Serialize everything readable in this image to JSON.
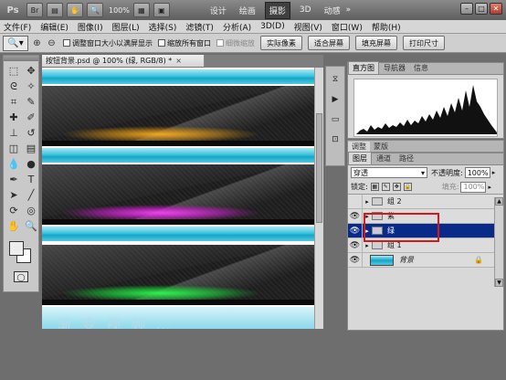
{
  "appbar": {
    "logo": "Ps",
    "zoom": "100%",
    "workspaces": [
      "设计",
      "绘画",
      "摄影",
      "3D",
      "动感"
    ],
    "active_workspace": "摄影",
    "more": "»"
  },
  "menu": [
    "文件(F)",
    "编辑(E)",
    "图像(I)",
    "图层(L)",
    "选择(S)",
    "滤镜(T)",
    "分析(A)",
    "3D(D)",
    "视图(V)",
    "窗口(W)",
    "帮助(H)"
  ],
  "options": {
    "checkbox_resize": "调整窗口大小以满屏显示",
    "checkbox_zoom_all": "缩放所有窗口",
    "checkbox_scrubby": "细微缩放",
    "btn_actual": "实际像素",
    "btn_fit": "适合屏幕",
    "btn_fill": "填充屏幕",
    "btn_print": "打印尺寸"
  },
  "document": {
    "tab_title": "按钮背景.psd @ 100% (绿, RGB/8) *",
    "close": "×",
    "faint_text": "渐 变 视 频 …"
  },
  "histogram": {
    "tabs": [
      "直方图",
      "导航器",
      "信息"
    ]
  },
  "adjust": {
    "tabs": [
      "调整",
      "蒙版"
    ]
  },
  "layers_panel": {
    "tabs": [
      "图层",
      "通道",
      "路径"
    ],
    "blend_mode": "穿透",
    "opacity_label": "不透明度:",
    "opacity_value": "100%",
    "lock_label": "锁定:",
    "fill_label": "填充:",
    "fill_value": "100%",
    "layers": [
      {
        "name": "组 2",
        "visible": false,
        "type": "group",
        "selected": false
      },
      {
        "name": "紫",
        "visible": true,
        "type": "group",
        "selected": false
      },
      {
        "name": "绿",
        "visible": true,
        "type": "group",
        "selected": true
      },
      {
        "name": "组 1",
        "visible": true,
        "type": "group",
        "selected": false
      },
      {
        "name": "背景",
        "visible": true,
        "type": "background",
        "selected": false
      }
    ]
  },
  "canvas_colors": {
    "orange_glow": "#e89a10",
    "magenta_glow": "#d41fd6",
    "green_glow": "#19d43a",
    "cyan": "#14a6c8"
  }
}
